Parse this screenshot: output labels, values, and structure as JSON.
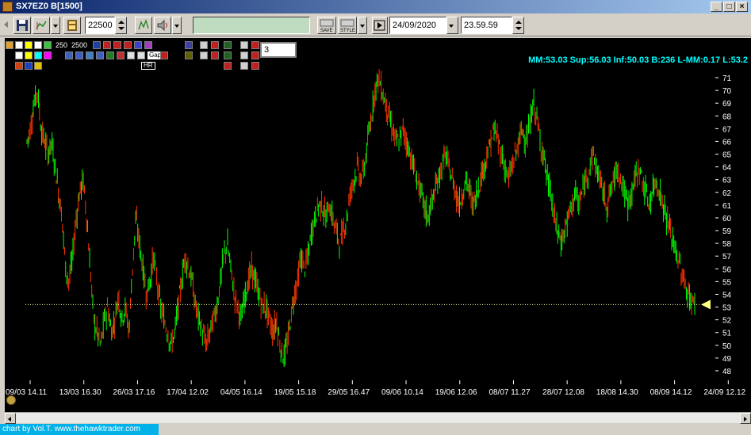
{
  "window": {
    "title": "SX7EZ0 B[1500]",
    "buttons": [
      "_",
      "□",
      "×"
    ]
  },
  "toolbar": {
    "bars_value": "22500",
    "date_value": "24/09/2020",
    "time_value": "23.59.59",
    "save_label": "SAVE",
    "style_label": "STYLE"
  },
  "overlay": {
    "settings_text": "250  2500",
    "period_value": "3",
    "hr_label": "HR",
    "gap_label": "Gap",
    "stats": "MM:53.03 Sup:56.03 Inf:50.03 B:236 L-MM:0.17 L:53.2"
  },
  "colors": {
    "background": "#000000",
    "up": "#00ff00",
    "down": "#ff3300",
    "axis_text": "#ffffff",
    "stats_text": "#00ffff",
    "ref_line": "#ffffa0",
    "marker": "#ffff80"
  },
  "chart_data": {
    "type": "bar",
    "description_free": true,
    "ylim": [
      47.5,
      71.5
    ],
    "yticks": [
      48,
      49,
      50,
      51,
      52,
      53,
      54,
      55,
      56,
      57,
      58,
      59,
      60,
      61,
      62,
      63,
      64,
      65,
      66,
      67,
      68,
      69,
      70,
      71
    ],
    "xticks": [
      "09/03 14.11",
      "13/03 16.30",
      "26/03 17.16",
      "17/04 12.02",
      "04/05 16.14",
      "19/05 15.18",
      "29/05 16.47",
      "09/06 10.14",
      "19/06 12.06",
      "08/07 11.27",
      "28/07 12.08",
      "18/08 14.30",
      "08/09 14.12",
      "24/09 12.12"
    ],
    "reference_line": 53.2,
    "series": [
      {
        "values": [
          66,
          67,
          69,
          70,
          67,
          66,
          65,
          66,
          64,
          62,
          60,
          56,
          55,
          57,
          60,
          62,
          63,
          60,
          56,
          52,
          51,
          50,
          52,
          53,
          51,
          52,
          54,
          52,
          53,
          51,
          56,
          60,
          58,
          56,
          54,
          55,
          57,
          55,
          53,
          52,
          51,
          50,
          51,
          53,
          55,
          57,
          56,
          55,
          53,
          52,
          51,
          50,
          51,
          52,
          53,
          55,
          57,
          58,
          56,
          54,
          53,
          52,
          54,
          55,
          56,
          55,
          54,
          53,
          53,
          52,
          51,
          52,
          50,
          49,
          50,
          52,
          54,
          55,
          57,
          56,
          57,
          59,
          60,
          61,
          61,
          60,
          61,
          60,
          59,
          58,
          59,
          60,
          62,
          63,
          64,
          63,
          64,
          66,
          68,
          70,
          71,
          70,
          69,
          68,
          67,
          66,
          66,
          67,
          66,
          65,
          64,
          63,
          62,
          61,
          60,
          61,
          62,
          63,
          64,
          65,
          64,
          63,
          62,
          61,
          62,
          63,
          62,
          61,
          62,
          63,
          64,
          65,
          66,
          67,
          66,
          65,
          64,
          63,
          64,
          65,
          66,
          67,
          66,
          67,
          69,
          68,
          66,
          65,
          63,
          62,
          60,
          59,
          58,
          59,
          60,
          61,
          62,
          61,
          62,
          63,
          64,
          65,
          64,
          63,
          62,
          61,
          62,
          63,
          64,
          63,
          62,
          61,
          62,
          63,
          64,
          63,
          62,
          61,
          62,
          63,
          62,
          61,
          60,
          59,
          58,
          57,
          56,
          55,
          54,
          53.5,
          53.2
        ]
      }
    ]
  },
  "statusbar": {
    "label": "chart by Vol.T. www.thehawktrader.com"
  }
}
